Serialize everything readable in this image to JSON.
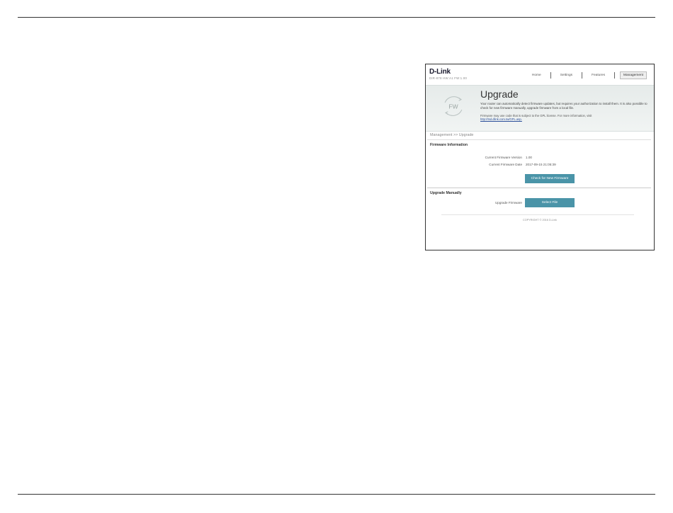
{
  "header": {
    "logo": "D-Link",
    "model": "DIR-878 HW:A1 FW:1.00"
  },
  "nav": {
    "items": [
      {
        "label": "Home"
      },
      {
        "label": "Settings"
      },
      {
        "label": "Features"
      },
      {
        "label": "Management"
      }
    ],
    "active": "Management"
  },
  "hero": {
    "icon_text": "FW",
    "title": "Upgrade",
    "description": "Your router can automatically detect firmware updates, but requires your authorization to install them. It is also possible to check for new firmware manually, upgrade firmware from a local file.",
    "note": "Firmware may use code that is subject to the GPL license. For more information, visit",
    "link": "http://tsd.dlink.com.tw/GPL.asp."
  },
  "breadcrumb": "Management >> Upgrade",
  "firmware_info": {
    "title": "Firmware Information",
    "version_label": "Current Firmware Version",
    "version_value": "1.00",
    "date_label": "Current Firmware Date",
    "date_value": "2017-09-15 21:05:39",
    "check_button": "Check for New Firmware"
  },
  "upgrade_manually": {
    "title": "Upgrade Manually",
    "field_label": "Upgrade Firmware",
    "select_button": "Select File"
  },
  "footer": {
    "copyright": "COPYRIGHT © 2016 D-Link"
  },
  "colors": {
    "button": "#4a94a8",
    "hero_bg": "#e6ebea",
    "link": "#2a4e9a"
  }
}
